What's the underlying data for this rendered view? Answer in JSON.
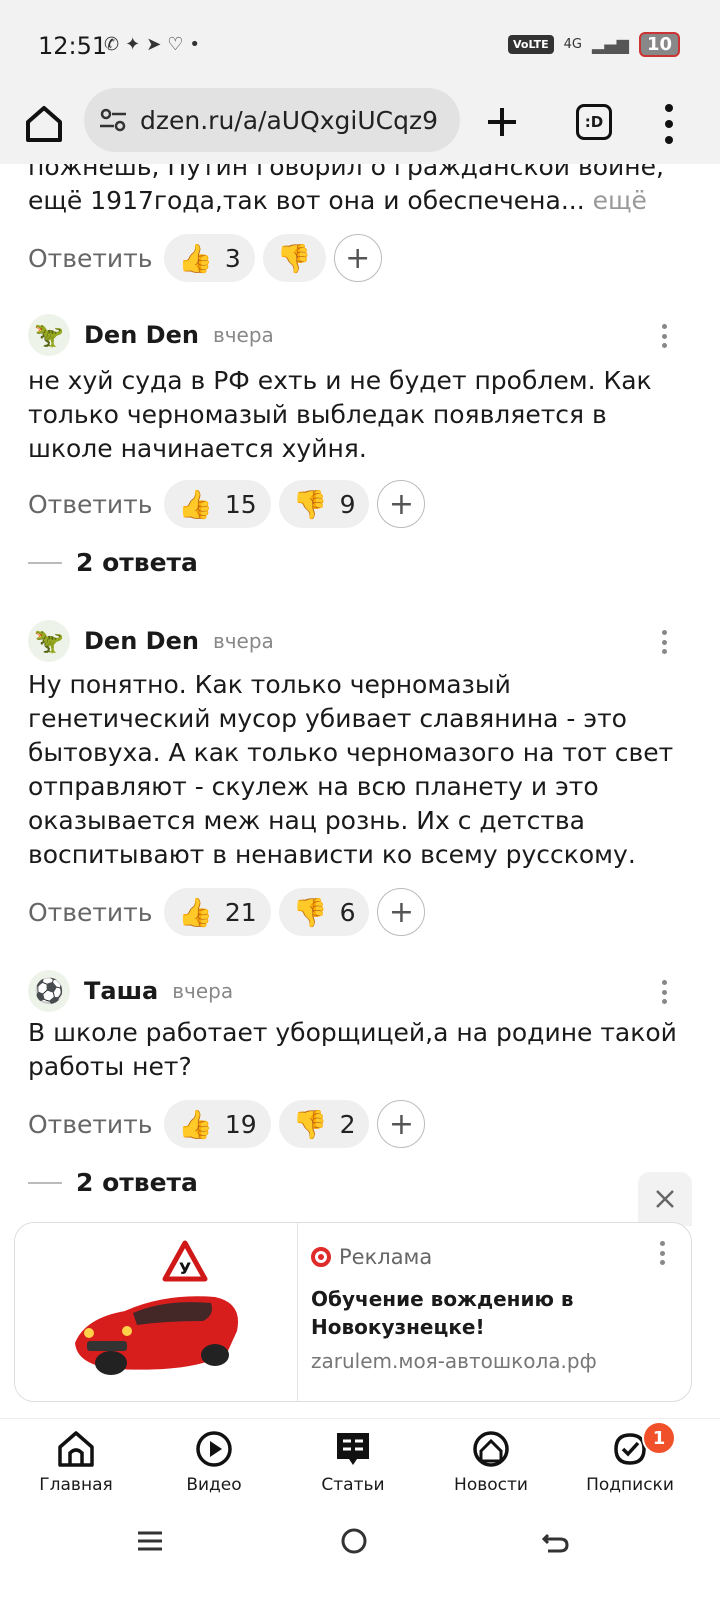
{
  "status_bar": {
    "time": "12:51",
    "notification_icons": [
      "whatsapp-icon",
      "chat-icon",
      "telegram-icon",
      "heart-app-icon",
      "dot-icon"
    ],
    "volte": "VoLTE",
    "network": "4G",
    "battery": "10"
  },
  "browser": {
    "url": "dzen.ru/a/aUQxgiUCqz9",
    "tabs_label": ":D"
  },
  "comments": [
    {
      "partial_text": "пожнешь, Путин говорил о гражданской войне, ещё 1917года,так вот она и обеспечена...",
      "more_label": "ещё",
      "reply_label": "Ответить",
      "likes": "3",
      "dislikes": ""
    },
    {
      "author": "Den Den",
      "date": "вчера",
      "avatar": "dinosaur-avatar",
      "text": "не хуй суда в РФ ехть и не будет проблем. Как только черномазый выбледак появляется в школе начинается хуйня.",
      "reply_label": "Ответить",
      "likes": "15",
      "dislikes": "9",
      "replies_label": "2 ответа"
    },
    {
      "author": "Den Den",
      "date": "вчера",
      "avatar": "dinosaur-avatar",
      "text": "Ну понятно. Как только черномазый генетический мусор убивает славянина - это бытовуха. А как только черномазого на тот свет отправляют - скулеж на всю планету и это оказывается меж нац рознь. Их с детства воспитывают в ненависти ко всему русскому.",
      "reply_label": "Ответить",
      "likes": "21",
      "dislikes": "6"
    },
    {
      "author": "Таша",
      "date": "вчера",
      "avatar": "soccer-ball-avatar",
      "text": "В школе работает уборщицей,а на родине такой работы нет?",
      "reply_label": "Ответить",
      "likes": "19",
      "dislikes": "2",
      "replies_label": "2 ответа"
    }
  ],
  "ad": {
    "label": "Реклама",
    "title": "Обучение вождению в Новокузнецке!",
    "domain": "zarulem.моя-автошкола.рф",
    "sign_letter": "У"
  },
  "bottom_nav": [
    {
      "label": "Главная",
      "icon": "home-icon"
    },
    {
      "label": "Видео",
      "icon": "video-icon"
    },
    {
      "label": "Статьи",
      "icon": "articles-icon"
    },
    {
      "label": "Новости",
      "icon": "news-icon"
    },
    {
      "label": "Подписки",
      "icon": "subscriptions-icon",
      "badge": "1"
    }
  ],
  "colors": {
    "accent_red": "#e02b2b",
    "badge_orange": "#f0502a",
    "pill_bg": "#efefef"
  }
}
